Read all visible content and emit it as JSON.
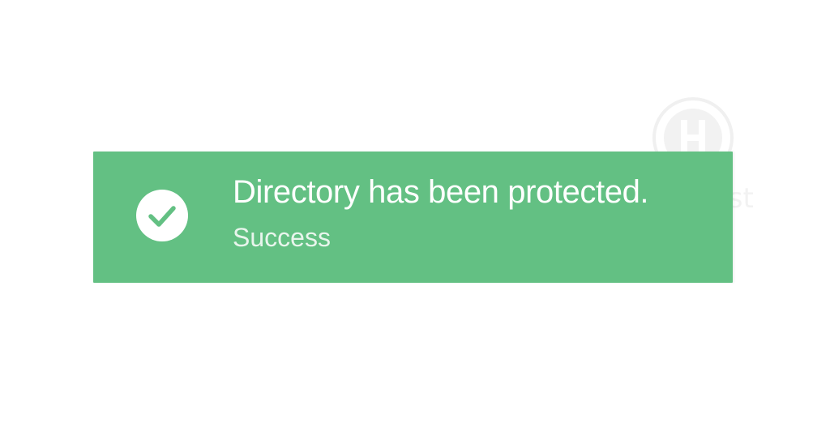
{
  "notification": {
    "title": "Directory has been protected.",
    "subtitle": "Success",
    "icon": "check-circle-icon",
    "background_color": "#63c083",
    "text_color": "#ffffff"
  },
  "watermark": {
    "icon": "logo-watermark-icon"
  }
}
